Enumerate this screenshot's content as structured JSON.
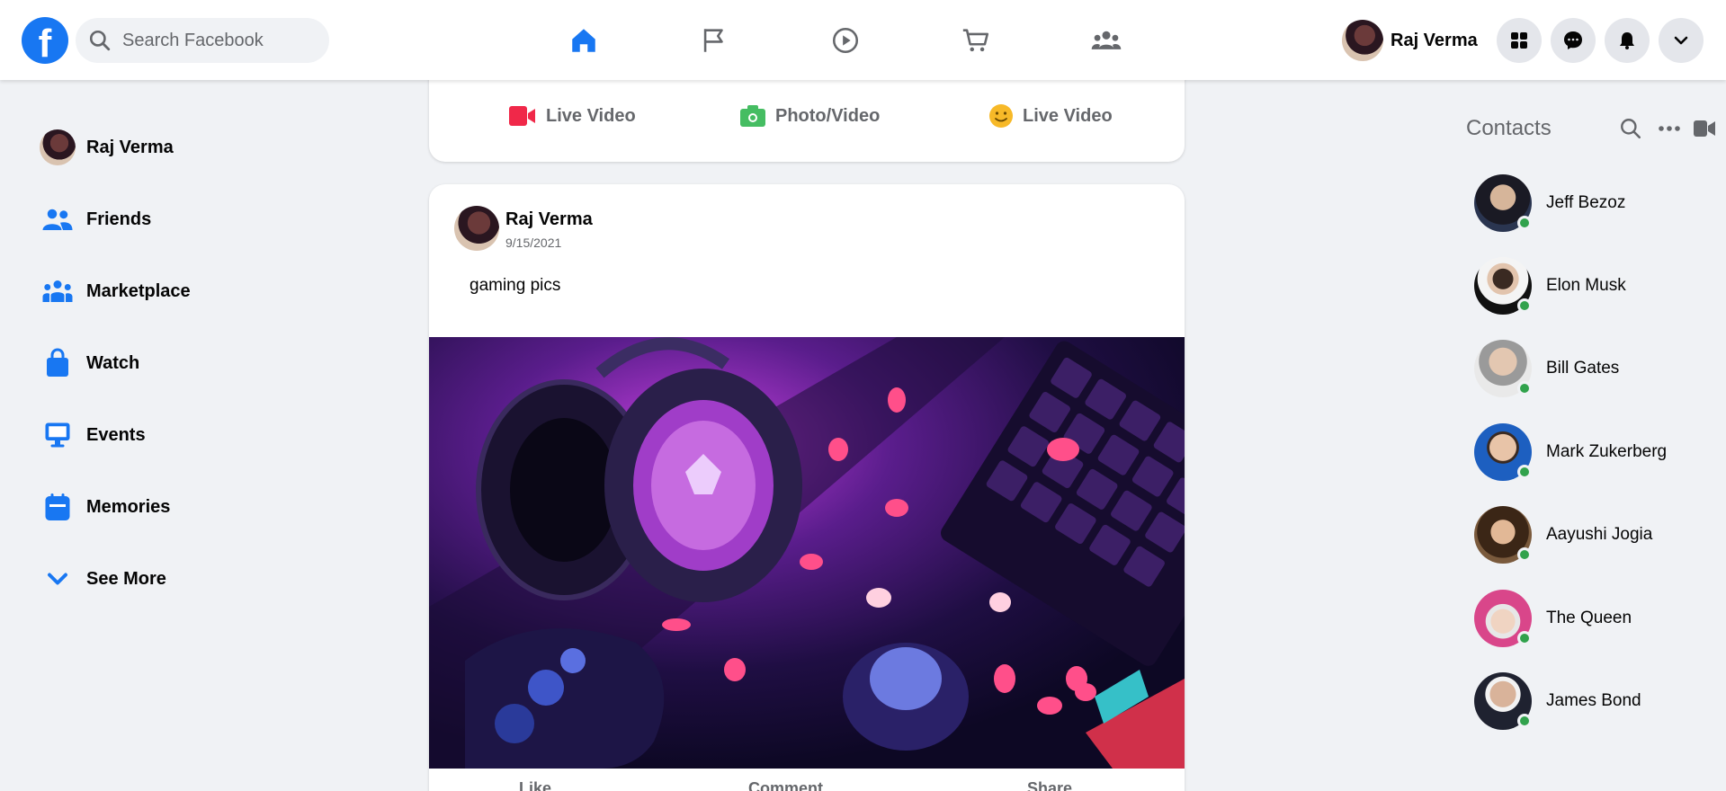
{
  "header": {
    "logo": "f",
    "search_placeholder": "Search Facebook",
    "profile_name": "Raj Verma",
    "nav_icons": [
      "home-icon",
      "flag-icon",
      "watch-icon",
      "marketplace-icon",
      "groups-icon"
    ],
    "action_icons": [
      "menu-grid-icon",
      "messenger-icon",
      "bell-icon",
      "chevron-down-icon"
    ],
    "accent": "#1877f2"
  },
  "sidebar": {
    "profile": "Raj Verma",
    "items": [
      {
        "label": "Friends",
        "icon": "friends-icon"
      },
      {
        "label": "Marketplace",
        "icon": "groups-icon"
      },
      {
        "label": "Watch",
        "icon": "shopping-bag-icon"
      },
      {
        "label": "Events",
        "icon": "monitor-icon"
      },
      {
        "label": "Memories",
        "icon": "calendar-icon"
      },
      {
        "label": "See More",
        "icon": "chevron-down-icon"
      }
    ]
  },
  "composer": {
    "buttons": [
      {
        "label": "Live Video",
        "icon": "video-camera-icon",
        "color": "#f02849"
      },
      {
        "label": "Photo/Video",
        "icon": "photo-icon",
        "color": "#45bd62"
      },
      {
        "label": "Live Video",
        "icon": "smiley-icon",
        "color": "#f7b928"
      }
    ]
  },
  "post": {
    "author": "Raj Verma",
    "date": "9/15/2021",
    "text": "gaming pics",
    "image_alt": "gaming setup with headset, keyboard and controller",
    "actions": [
      "Like",
      "Comment",
      "Share"
    ]
  },
  "contacts": {
    "title": "Contacts",
    "header_icons": [
      "search-icon",
      "more-icon",
      "video-icon"
    ],
    "people": [
      {
        "name": "Jeff Bezoz",
        "online": true
      },
      {
        "name": "Elon Musk",
        "online": true
      },
      {
        "name": "Bill Gates",
        "online": true
      },
      {
        "name": "Mark Zukerberg",
        "online": true
      },
      {
        "name": "Aayushi Jogia",
        "online": true
      },
      {
        "name": "The Queen",
        "online": true
      },
      {
        "name": "James Bond",
        "online": true
      }
    ]
  }
}
